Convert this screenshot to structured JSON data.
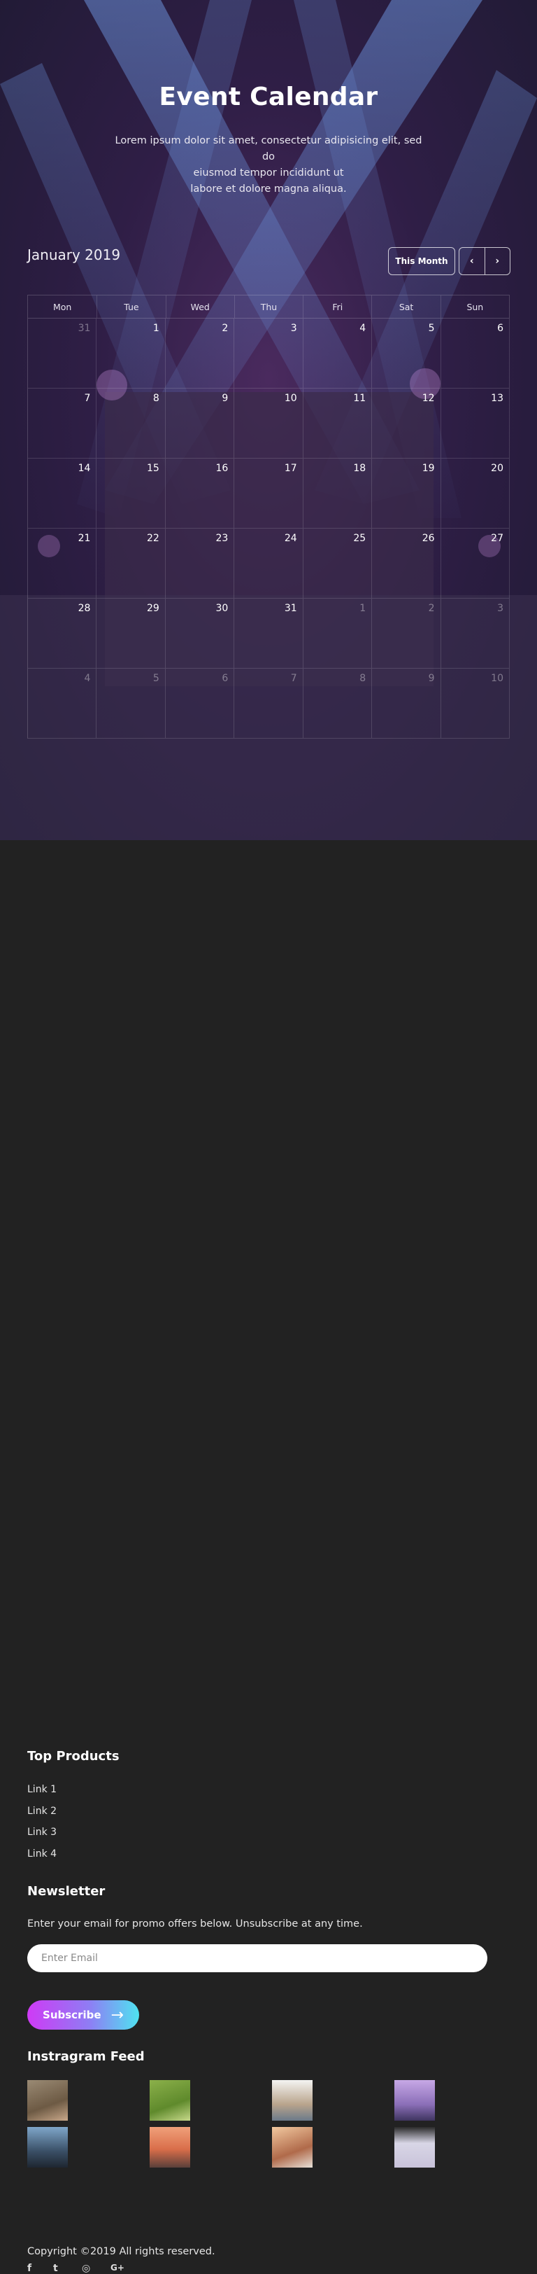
{
  "hero": {
    "title": "Event Calendar",
    "lead_line1": "Lorem ipsum dolor sit amet, consectetur adipisicing elit, sed do",
    "lead_line2": "eiusmod tempor incididunt ut",
    "lead_line3": "labore et dolore magna aliqua."
  },
  "calendar": {
    "month_label": "January 2019",
    "this_month_label": "This Month",
    "prev_icon": "‹",
    "next_icon": "›",
    "weekdays": [
      "Mon",
      "Tue",
      "Wed",
      "Thu",
      "Fri",
      "Sat",
      "Sun"
    ],
    "days": [
      {
        "d": "31",
        "muted": true
      },
      {
        "d": "1"
      },
      {
        "d": "2"
      },
      {
        "d": "3"
      },
      {
        "d": "4"
      },
      {
        "d": "5"
      },
      {
        "d": "6"
      },
      {
        "d": "7"
      },
      {
        "d": "8"
      },
      {
        "d": "9"
      },
      {
        "d": "10"
      },
      {
        "d": "11"
      },
      {
        "d": "12"
      },
      {
        "d": "13"
      },
      {
        "d": "14"
      },
      {
        "d": "15"
      },
      {
        "d": "16"
      },
      {
        "d": "17"
      },
      {
        "d": "18"
      },
      {
        "d": "19"
      },
      {
        "d": "20"
      },
      {
        "d": "21"
      },
      {
        "d": "22"
      },
      {
        "d": "23"
      },
      {
        "d": "24"
      },
      {
        "d": "25"
      },
      {
        "d": "26"
      },
      {
        "d": "27"
      },
      {
        "d": "28"
      },
      {
        "d": "29"
      },
      {
        "d": "30"
      },
      {
        "d": "31"
      },
      {
        "d": "1",
        "muted": true
      },
      {
        "d": "2",
        "muted": true
      },
      {
        "d": "3",
        "muted": true
      },
      {
        "d": "4",
        "muted": true
      },
      {
        "d": "5",
        "muted": true
      },
      {
        "d": "6",
        "muted": true
      },
      {
        "d": "7",
        "muted": true
      },
      {
        "d": "8",
        "muted": true
      },
      {
        "d": "9",
        "muted": true
      },
      {
        "d": "10",
        "muted": true
      }
    ]
  },
  "footer": {
    "top_products_title": "Top Products",
    "links": [
      "Link 1",
      "Link 2",
      "Link 3",
      "Link 4"
    ],
    "newsletter_title": "Newsletter",
    "newsletter_text": "Enter your email for promo offers below. Unsubscribe at any time.",
    "email_placeholder": "Enter Email",
    "subscribe_label": "Subscribe",
    "subscribe_icon": "→",
    "instagram_title": "Instragram Feed",
    "copyright": "Copyright ©2019 All rights reserved.",
    "social": {
      "facebook": "f",
      "twitter": "t",
      "instagram": "◎",
      "google": "G+"
    }
  },
  "colors": {
    "footer_bg": "#222222",
    "hero_purple": "#4a2a5e",
    "subscribe_start": "#cf3af5",
    "subscribe_end": "#4fe3f0"
  }
}
